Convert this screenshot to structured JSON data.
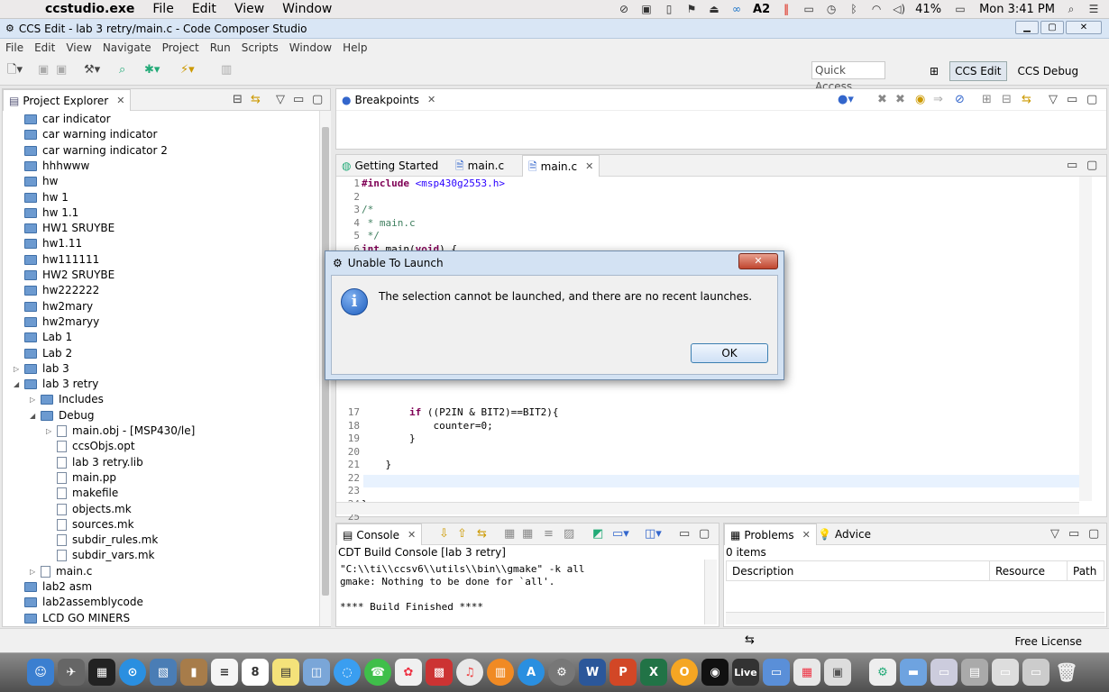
{
  "macbar": {
    "app": "ccstudio.exe",
    "menus": [
      "File",
      "Edit",
      "View",
      "Window"
    ],
    "battery": "41%",
    "clock": "Mon 3:41 PM",
    "badge2": "2"
  },
  "window": {
    "title": "CCS Edit - lab 3 retry/main.c - Code Composer Studio"
  },
  "menubar": [
    "File",
    "Edit",
    "View",
    "Navigate",
    "Project",
    "Run",
    "Scripts",
    "Window",
    "Help"
  ],
  "toolbar": {
    "quick_access": "Quick Access",
    "persp_edit": "CCS Edit",
    "persp_debug": "CCS Debug"
  },
  "project_explorer": {
    "title": "Project Explorer",
    "items": [
      {
        "label": "car indicator",
        "indent": 0,
        "kind": "folder"
      },
      {
        "label": "car warning indicator",
        "indent": 0,
        "kind": "folder"
      },
      {
        "label": "car warning indicator 2",
        "indent": 0,
        "kind": "folder"
      },
      {
        "label": "hhhwww",
        "indent": 0,
        "kind": "folder"
      },
      {
        "label": "hw",
        "indent": 0,
        "kind": "folder"
      },
      {
        "label": "hw 1",
        "indent": 0,
        "kind": "folder"
      },
      {
        "label": "hw 1.1",
        "indent": 0,
        "kind": "folder"
      },
      {
        "label": "HW1 SRUYBE",
        "indent": 0,
        "kind": "folder"
      },
      {
        "label": "hw1.11",
        "indent": 0,
        "kind": "folder"
      },
      {
        "label": "hw111111",
        "indent": 0,
        "kind": "folder"
      },
      {
        "label": "HW2 SRUYBE",
        "indent": 0,
        "kind": "folder"
      },
      {
        "label": "hw222222",
        "indent": 0,
        "kind": "folder"
      },
      {
        "label": "hw2mary",
        "indent": 0,
        "kind": "folder"
      },
      {
        "label": "hw2maryy",
        "indent": 0,
        "kind": "folder"
      },
      {
        "label": "Lab 1",
        "indent": 0,
        "kind": "folder"
      },
      {
        "label": "Lab 2",
        "indent": 0,
        "kind": "folder"
      },
      {
        "label": "lab 3",
        "indent": 0,
        "kind": "folder",
        "twisty": "▷"
      },
      {
        "label": "lab 3 retry",
        "indent": 0,
        "kind": "folder",
        "twisty": "◢"
      },
      {
        "label": "Includes",
        "indent": 1,
        "kind": "folder",
        "twisty": "▷"
      },
      {
        "label": "Debug",
        "indent": 1,
        "kind": "folder",
        "twisty": "◢"
      },
      {
        "label": "main.obj - [MSP430/le]",
        "indent": 2,
        "kind": "file",
        "twisty": "▷"
      },
      {
        "label": "ccsObjs.opt",
        "indent": 2,
        "kind": "file"
      },
      {
        "label": "lab 3 retry.lib",
        "indent": 2,
        "kind": "file"
      },
      {
        "label": "main.pp",
        "indent": 2,
        "kind": "file"
      },
      {
        "label": "makefile",
        "indent": 2,
        "kind": "file"
      },
      {
        "label": "objects.mk",
        "indent": 2,
        "kind": "file"
      },
      {
        "label": "sources.mk",
        "indent": 2,
        "kind": "file"
      },
      {
        "label": "subdir_rules.mk",
        "indent": 2,
        "kind": "file"
      },
      {
        "label": "subdir_vars.mk",
        "indent": 2,
        "kind": "file"
      },
      {
        "label": "main.c",
        "indent": 1,
        "kind": "file",
        "twisty": "▷"
      },
      {
        "label": "lab2 asm",
        "indent": 0,
        "kind": "folder"
      },
      {
        "label": "lab2assemblycode",
        "indent": 0,
        "kind": "folder"
      },
      {
        "label": "LCD GO MINERS",
        "indent": 0,
        "kind": "folder"
      }
    ]
  },
  "breakpoints": {
    "title": "Breakpoints"
  },
  "editor": {
    "tabs": [
      "Getting Started",
      "main.c",
      "main.c"
    ],
    "lines_top": [
      {
        "n": "1",
        "code": "#include <msp430g2553.h>"
      },
      {
        "n": "2",
        "code": ""
      },
      {
        "n": "3",
        "code": "/*"
      },
      {
        "n": "4",
        "code": " * main.c"
      },
      {
        "n": "5",
        "code": " */"
      },
      {
        "n": "6",
        "code": "int main(void) {"
      }
    ],
    "lines_bottom": [
      {
        "n": "17",
        "code": "        if ((P2IN & BIT2)==BIT2){"
      },
      {
        "n": "18",
        "code": "            counter=0;"
      },
      {
        "n": "19",
        "code": "        }"
      },
      {
        "n": "20",
        "code": ""
      },
      {
        "n": "21",
        "code": "    }"
      },
      {
        "n": "22",
        "code": ""
      },
      {
        "n": "23",
        "code": ""
      },
      {
        "n": "24",
        "code": "}"
      },
      {
        "n": "25",
        "code": ""
      }
    ]
  },
  "console": {
    "title": "Console",
    "subtitle": "CDT Build Console [lab 3 retry]",
    "lines": [
      "\"C:\\\\ti\\\\ccsv6\\\\utils\\\\bin\\\\gmake\" -k all",
      "gmake: Nothing to be done for `all'.",
      "",
      "**** Build Finished ****"
    ]
  },
  "problems": {
    "title": "Problems",
    "advice": "Advice",
    "count": "0 items",
    "columns": [
      "Description",
      "Resource",
      "Path"
    ]
  },
  "status": {
    "license": "Free License"
  },
  "dialog": {
    "title": "Unable To Launch",
    "message": "The selection cannot be launched, and there are no recent launches.",
    "ok": "OK"
  },
  "dock": {
    "calendar_day": "8",
    "live": "Live"
  }
}
